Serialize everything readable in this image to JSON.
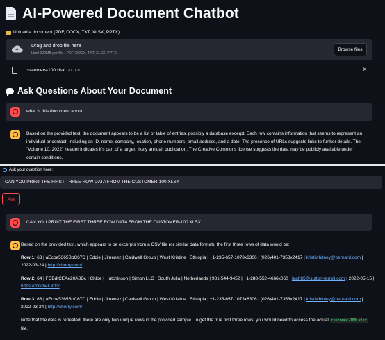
{
  "header": {
    "title": "AI-Powered Document Chatbot",
    "upload_label": "Upload a document (PDF, DOCX, TXT, XLSX, PPTX)"
  },
  "dropzone": {
    "title": "Drag and drop file here",
    "limit": "Limit 200MB per file • PDF, DOCX, TXT, XLSX, PPTX",
    "browse_label": "Browse files"
  },
  "file": {
    "name": "customers-100.xlsx",
    "size": "20.7KB",
    "remove_symbol": "×"
  },
  "section": {
    "title": "Ask Questions About Your Document"
  },
  "chat_top": {
    "user_message": "what is this document about",
    "bot_message": "Based on the provided text, the document appears to be a list or table of entries, possibly a database excerpt. Each row contains information that seems to represent an individual or contact, including an ID, name, company, location, phone numbers, email address, and a date. The presence of URLs suggests links to further details. The \"Volume 10, 2022\" header indicates it's part of a larger, likely annual, publication. The Creative Commons license suggests the data may be publicly available under certain conditions."
  },
  "question": {
    "label": "Ask your question here:",
    "value": "CAN YOU PRINT THE FIRST THREE ROW DATA FROM THE CUSTOMER-100.XLSX",
    "ask_label": "Ask"
  },
  "chat_bottom": {
    "user_message": "CAN YOU PRINT THE FIRST THREE ROW DATA FROM THE CUSTOMER-100.XLSX",
    "intro": "Based on the provided text, which appears to be excerpts from a CSV file (or similar data format), the first three rows of data would be:",
    "rows": [
      {
        "label": "Row 1:",
        "text": " 63 | aEcbe5365BbC67D | Eddie | Jimenez | Caldwell Group | West Kristine | Ethiopia | +1-235-657-1073x6306 | (026)401-7353x2417 | ",
        "email": "kristiwhitney@bernard.com",
        "date": " | 2022-03-24 | ",
        "url": "http://cherry.com/"
      },
      {
        "label": "Row 2:",
        "text": " 64 | FCBdfCEAe20A8Dc | Chloe | Hutchinson | Simon LLC | South Julia | Netherlands | 981-544-9452 | +1-288-552-4666x060 | ",
        "email": "leah85@sutton-terrell.com",
        "date": " | 2022-05-15 | ",
        "url": "https://mitchell.info/"
      },
      {
        "label": "Row 3:",
        "text": " 63 | aEcbe5365BbC67D | Eddie | Jimenez | Caldwell Group | West Kristine | Ethiopia | +1-235-657-1073x6306 | (026)401-7353x2417 | ",
        "email": "kristiwhitney@bernard.com",
        "date": " | 2022-03-24 | ",
        "url": "http://cherry.com/"
      }
    ],
    "note_before": "Note that the data is repeated; there are only two unique rows in the provided sample. To get the true first three rows, you would need to access the actual ",
    "note_code": "customer-100.xlsx",
    "note_after": " file."
  },
  "colors": {
    "background": "#0e1117",
    "panel": "#262730",
    "accent_red": "#ff4b4b",
    "bot_avatar": "#ffbd45",
    "link": "#6fb1ff"
  },
  "icons": [
    "document-icon",
    "folder-icon",
    "cloud-upload-icon",
    "file-icon",
    "close-icon",
    "speech-bubble-icon",
    "user-avatar-icon",
    "bot-avatar-icon",
    "magnifier-icon"
  ]
}
